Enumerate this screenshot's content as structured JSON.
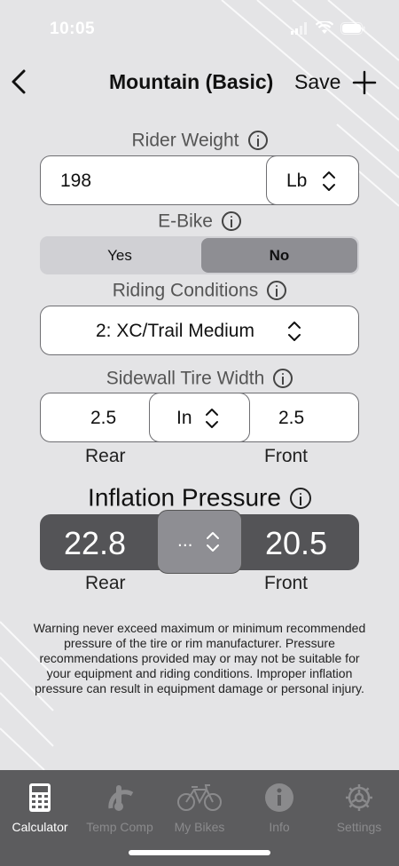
{
  "status": {
    "time": "10:05"
  },
  "nav": {
    "title": "Mountain (Basic)",
    "save_label": "Save"
  },
  "rider_weight": {
    "label": "Rider Weight",
    "value": "198",
    "unit": "Lb"
  },
  "ebike": {
    "label": "E-Bike",
    "options": [
      "Yes",
      "No"
    ],
    "selected": "No"
  },
  "riding_conditions": {
    "label": "Riding Conditions",
    "value": "2: XC/Trail Medium"
  },
  "tire_width": {
    "label": "Sidewall Tire Width",
    "rear": "2.5",
    "unit": "In",
    "front": "2.5",
    "rear_label": "Rear",
    "front_label": "Front"
  },
  "inflation": {
    "label": "Inflation Pressure",
    "rear": "22.8",
    "unit": "...",
    "front": "20.5",
    "rear_label": "Rear",
    "front_label": "Front"
  },
  "warning": "Warning never exceed maximum or minimum recommended pressure of the tire or rim manufacturer. Pressure recommendations provided may or may not be suitable for your equipment and riding conditions. Improper inflation pressure can result in equipment damage or personal injury.",
  "tabs": [
    {
      "label": "Calculator",
      "icon": "calculator-icon",
      "active": true
    },
    {
      "label": "Temp Comp",
      "icon": "thermometer-gauge-icon",
      "active": false
    },
    {
      "label": "My Bikes",
      "icon": "bicycle-icon",
      "active": false
    },
    {
      "label": "Info",
      "icon": "info-icon",
      "active": false
    },
    {
      "label": "Settings",
      "icon": "gear-icon",
      "active": false
    }
  ],
  "colors": {
    "background": "#e4e4e6",
    "tabbar": "#5c5c5e",
    "pressure_bar": "#545457",
    "selected_segment": "#8e8e93"
  }
}
